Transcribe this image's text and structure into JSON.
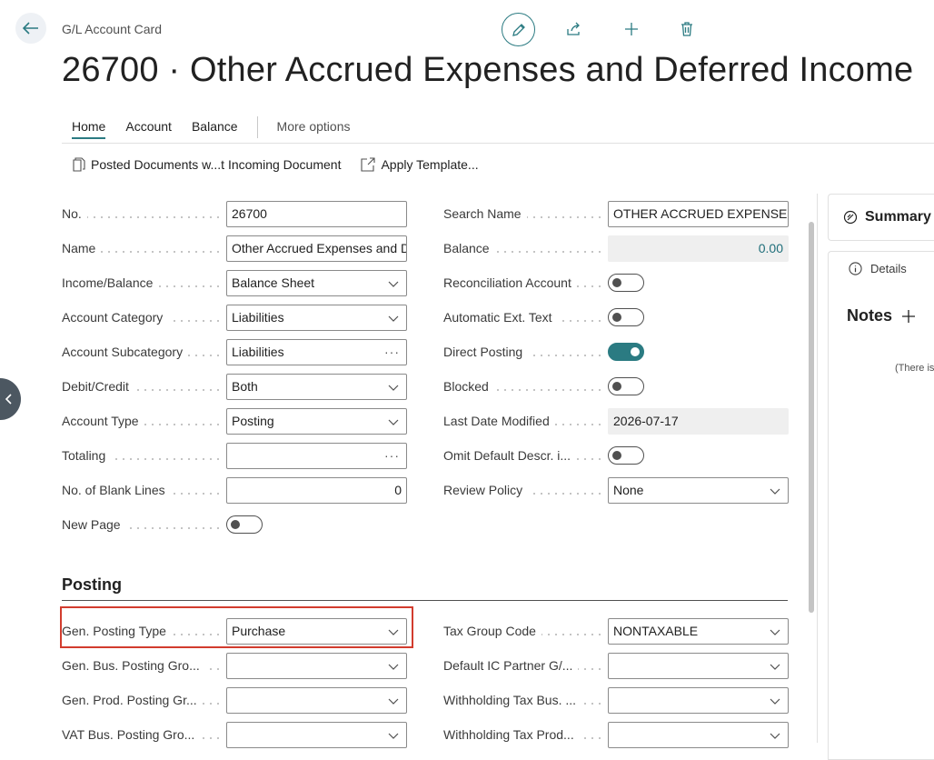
{
  "header": {
    "caption": "G/L Account Card",
    "title": "26700 · Other Accrued Expenses and Deferred Income"
  },
  "tabs": [
    {
      "label": "Home",
      "active": true
    },
    {
      "label": "Account"
    },
    {
      "label": "Balance"
    },
    {
      "label": "More options"
    }
  ],
  "actions": {
    "posted_docs": "Posted Documents w...t Incoming Document",
    "apply_template": "Apply Template..."
  },
  "left_fields": [
    {
      "label": "No.",
      "value": "26700",
      "kind": "text"
    },
    {
      "label": "Name",
      "value": "Other Accrued Expenses and D",
      "kind": "text"
    },
    {
      "label": "Income/Balance",
      "value": "Balance Sheet",
      "kind": "select"
    },
    {
      "label": "Account Category",
      "value": "Liabilities",
      "kind": "select"
    },
    {
      "label": "Account Subcategory",
      "value": "Liabilities",
      "kind": "lookup"
    },
    {
      "label": "Debit/Credit",
      "value": "Both",
      "kind": "select"
    },
    {
      "label": "Account Type",
      "value": "Posting",
      "kind": "select"
    },
    {
      "label": "Totaling",
      "value": "",
      "kind": "lookup"
    },
    {
      "label": "No. of Blank Lines",
      "value": "0",
      "kind": "number"
    },
    {
      "label": "New Page",
      "value": false,
      "kind": "toggle"
    }
  ],
  "right_fields": [
    {
      "label": "Search Name",
      "value": "OTHER ACCRUED EXPENSES AI",
      "kind": "text"
    },
    {
      "label": "Balance",
      "value": "0.00",
      "kind": "readonly-number"
    },
    {
      "label": "Reconciliation Account",
      "value": false,
      "kind": "toggle"
    },
    {
      "label": "Automatic Ext. Text",
      "value": false,
      "kind": "toggle"
    },
    {
      "label": "Direct Posting",
      "value": true,
      "kind": "toggle"
    },
    {
      "label": "Blocked",
      "value": false,
      "kind": "toggle"
    },
    {
      "label": "Last Date Modified",
      "value": "2026-07-17",
      "kind": "readonly"
    },
    {
      "label": "Omit Default Descr. i...",
      "value": false,
      "kind": "toggle"
    },
    {
      "label": "Review Policy",
      "value": "None",
      "kind": "select"
    }
  ],
  "posting": {
    "title": "Posting",
    "left_fields": [
      {
        "label": "Gen. Posting Type",
        "value": "Purchase",
        "kind": "select"
      },
      {
        "label": "Gen. Bus. Posting Gro...",
        "value": "",
        "kind": "select"
      },
      {
        "label": "Gen. Prod. Posting Gr...",
        "value": "",
        "kind": "select"
      },
      {
        "label": "VAT Bus. Posting Gro...",
        "value": "",
        "kind": "select"
      }
    ],
    "right_fields": [
      {
        "label": "Tax Group Code",
        "value": "NONTAXABLE",
        "kind": "select"
      },
      {
        "label": "Default IC Partner G/...",
        "value": "",
        "kind": "select"
      },
      {
        "label": "Withholding Tax Bus. ...",
        "value": "",
        "kind": "select"
      },
      {
        "label": "Withholding Tax Prod...",
        "value": "",
        "kind": "select"
      }
    ]
  },
  "factbox": {
    "summary": "Summary",
    "details": "Details",
    "notes": "Notes",
    "notes_empty": "(There is"
  },
  "colors": {
    "accent": "#2b7b82",
    "highlight": "#d23c2e"
  }
}
